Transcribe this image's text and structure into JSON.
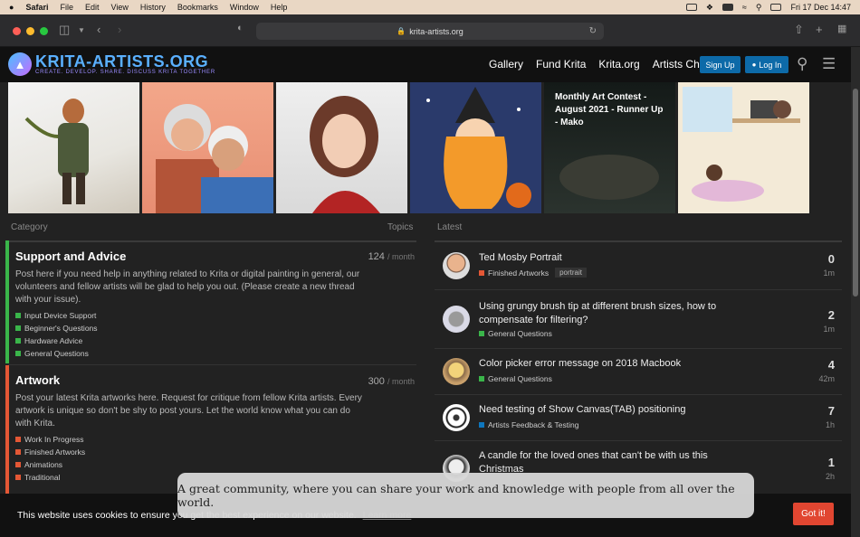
{
  "menubar": {
    "apple": "",
    "app": "Safari",
    "items": [
      "File",
      "Edit",
      "View",
      "History",
      "Bookmarks",
      "Window",
      "Help"
    ],
    "clock": "Fri 17 Dec  14:47"
  },
  "browser": {
    "url": "krita-artists.org"
  },
  "site": {
    "logo_name": "KRITA-ARTISTS.ORG",
    "logo_tagline": "CREATE. DEVELOP. SHARE. DISCUSS KRITA TOGETHER",
    "nav": [
      "Gallery",
      "Fund Krita",
      "Krita.org",
      "Artists Chat"
    ],
    "signup": "Sign Up",
    "login": "Log In",
    "banner_caption": "Monthly Art Contest - August 2021 - Runner Up - Mako"
  },
  "categories_header": {
    "category": "Category",
    "topics": "Topics",
    "latest": "Latest"
  },
  "categories": [
    {
      "title": "Support and Advice",
      "count": "124",
      "per": "/ month",
      "color": "#3ab54a",
      "description": "Post here if you need help in anything related to Krita or digital painting in general, our volunteers and fellow artists will be glad to help you out. (Please create a new thread with your issue).",
      "subs": [
        "Input Device Support",
        "Beginner's Questions",
        "Hardware Advice",
        "General Questions"
      ]
    },
    {
      "title": "Artwork",
      "count": "300",
      "per": "/ month",
      "color": "#e45735",
      "description": "Post your latest Krita artworks here. Request for critique from fellow Krita artists. Every artwork is unique so don't be shy to post yours. Let the world know what you can do with Krita.",
      "subs": [
        "Work In Progress",
        "Finished Artworks",
        "Animations",
        "Traditional"
      ]
    }
  ],
  "topics": [
    {
      "title": "Ted Mosby Portrait",
      "category": "Finished Artworks",
      "cat_color": "#e45735",
      "tag": "portrait",
      "replies": "0",
      "ago": "1m"
    },
    {
      "title": "Using grungy brush tip at different brush sizes, how to compensate for filtering?",
      "category": "General Questions",
      "cat_color": "#3ab54a",
      "tag": "",
      "replies": "2",
      "ago": "1m"
    },
    {
      "title": "Color picker error message on 2018 Macbook",
      "category": "General Questions",
      "cat_color": "#3ab54a",
      "tag": "",
      "replies": "4",
      "ago": "42m"
    },
    {
      "title": "Need testing of Show Canvas(TAB) positioning",
      "category": "Artists Feedback & Testing",
      "cat_color": "#0e76bd",
      "tag": "",
      "replies": "7",
      "ago": "1h"
    },
    {
      "title": "A candle for the loved ones that can't be with us this Christmas",
      "category": "",
      "cat_color": "#e45735",
      "tag": "",
      "replies": "1",
      "ago": "2h"
    }
  ],
  "cookie": {
    "text": "This website uses cookies to ensure you get the best experience on our website.",
    "learn_more": "Learn more",
    "button": "Got it!"
  },
  "toast": "A great community, where you can share your work and knowledge with people from all over the world."
}
